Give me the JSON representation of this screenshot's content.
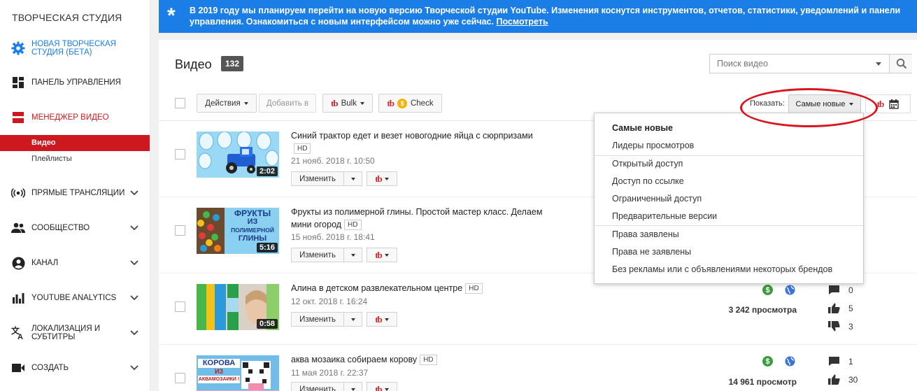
{
  "sidebar": {
    "brand": "ТВОРЧЕСКАЯ СТУДИЯ",
    "new_studio": "НОВАЯ ТВОРЧЕСКАЯ СТУДИЯ (БЕТА)",
    "dashboard": "ПАНЕЛЬ УПРАВЛЕНИЯ",
    "video_manager": "МЕНЕДЖЕР ВИДЕО",
    "sub_videos": "Видео",
    "sub_playlists": "Плейлисты",
    "live": "ПРЯМЫЕ ТРАНСЛЯЦИИ",
    "community": "СООБЩЕСТВО",
    "channel": "КАНАЛ",
    "analytics": "YOUTUBE ANALYTICS",
    "localization": "ЛОКАЛИЗАЦИЯ И СУБТИТРЫ",
    "create": "СОЗДАТЬ"
  },
  "banner": {
    "text": "В 2019 году мы планируем перейти на новую версию Творческой студии YouTube. Изменения коснутся инструментов, отчетов, статистики, уведомлений и панели управления. Ознакомиться с новым интерфейсом можно уже сейчас.",
    "link": "Посмотреть"
  },
  "header": {
    "title": "Видео",
    "count": "132",
    "search_placeholder": "Поиск видео"
  },
  "toolbar": {
    "actions": "Действия",
    "add_to": "Добавить в",
    "bulk": "Bulk",
    "check": "Check",
    "show_label": "Показать:",
    "sort_value": "Самые новые"
  },
  "menu": {
    "items": [
      "Самые новые",
      "Лидеры просмотров",
      "Открытый доступ",
      "Доступ по ссылке",
      "Ограниченный доступ",
      "Предварительные версии",
      "Права заявлены",
      "Права не заявлены",
      "Без рекламы или с объявлениями некоторых брендов"
    ]
  },
  "common": {
    "edit": "Изменить",
    "hd": "HD",
    "tb": "tb"
  },
  "videos": [
    {
      "title": "Синий трактор едет и везет новогодние яйца с сюрпризами",
      "date": "21 нояб. 2018 г. 10:50",
      "duration": "2:02"
    },
    {
      "title": "Фрукты из полимерной глины. Простой мастер класс. Делаем мини огород",
      "date": "15 нояб. 2018 г. 18:41",
      "duration": "5:16",
      "thumb_text": [
        "ФРУКТЫ",
        "ИЗ",
        "ПОЛИМЕРНОЙ",
        "ГЛИНЫ"
      ]
    },
    {
      "title": "Алина в детском развлекательном центре",
      "date": "12 окт. 2018 г. 16:24",
      "duration": "0:58",
      "views": "3 242 просмотра",
      "comments": "0",
      "likes": "5",
      "dislikes": "3"
    },
    {
      "title": "аква мозаика собираем корову",
      "date": "11 мая 2018 г. 22:37",
      "views": "14 961 просмотр",
      "comments": "1",
      "likes": "30",
      "thumb_text": [
        "КОРОВА",
        "ИЗ",
        "АКВАМОЗАИКИ !"
      ]
    }
  ],
  "colors": {
    "accent_red": "#cc181e",
    "banner_blue": "#1a7ee6",
    "annotation_red": "#d9161d"
  }
}
